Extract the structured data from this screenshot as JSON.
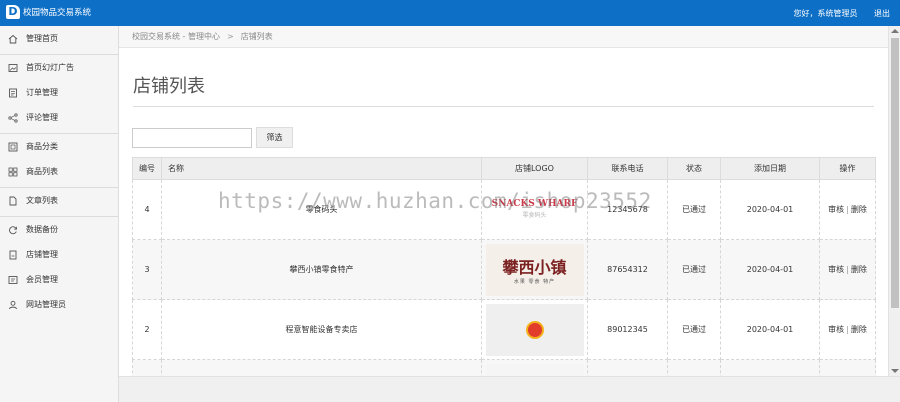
{
  "app": {
    "logo_letter": "D",
    "title": "校园物品交易系统",
    "greeting": "您好，系统管理员",
    "logout": "退出"
  },
  "sidebar": {
    "items": [
      {
        "label": "管理首页",
        "icon": "home-icon"
      },
      {
        "label": "首页幻灯广告",
        "icon": "image-icon"
      },
      {
        "label": "订单管理",
        "icon": "order-icon"
      },
      {
        "label": "评论管理",
        "icon": "share-icon"
      },
      {
        "label": "商品分类",
        "icon": "category-icon"
      },
      {
        "label": "商品列表",
        "icon": "grid-icon"
      },
      {
        "label": "文章列表",
        "icon": "document-icon"
      },
      {
        "label": "数据备份",
        "icon": "refresh-icon"
      },
      {
        "label": "店铺管理",
        "icon": "shop-icon"
      },
      {
        "label": "会员管理",
        "icon": "member-icon"
      },
      {
        "label": "网站管理员",
        "icon": "user-icon"
      }
    ]
  },
  "breadcrumb": {
    "root": "校园交易系统 - 管理中心",
    "sep": ">",
    "current": "店铺列表"
  },
  "page": {
    "title": "店铺列表",
    "filter_placeholder": "",
    "filter_button": "筛选"
  },
  "table": {
    "headers": [
      "编号",
      "名称",
      "店铺LOGO",
      "联系电话",
      "状态",
      "添加日期",
      "操作"
    ],
    "rows": [
      {
        "id": "4",
        "name": "零食码头",
        "logo_text": "SNACKS WHARF",
        "logo_sub": "零食码头",
        "phone": "12345678",
        "status": "已通过",
        "date": "2020-04-01",
        "op_audit": "审核",
        "op_delete": "删除"
      },
      {
        "id": "3",
        "name": "攀西小镇零食特产",
        "logo_text": "攀西小镇",
        "logo_sub": "水果 零食 特产",
        "phone": "87654312",
        "status": "已通过",
        "date": "2020-04-01",
        "op_audit": "审核",
        "op_delete": "删除"
      },
      {
        "id": "2",
        "name": "程意智能设备专卖店",
        "logo_text": "",
        "logo_sub": "",
        "phone": "89012345",
        "status": "已通过",
        "date": "2020-04-01",
        "op_audit": "审核",
        "op_delete": "删除"
      },
      {
        "id": "",
        "name": "",
        "logo_text": "",
        "logo_sub": "",
        "phone": "",
        "status": "",
        "date": "",
        "op_audit": "",
        "op_delete": ""
      }
    ],
    "op_separator": "|"
  },
  "watermark": "https://www.huzhan.com/ishop23552"
}
